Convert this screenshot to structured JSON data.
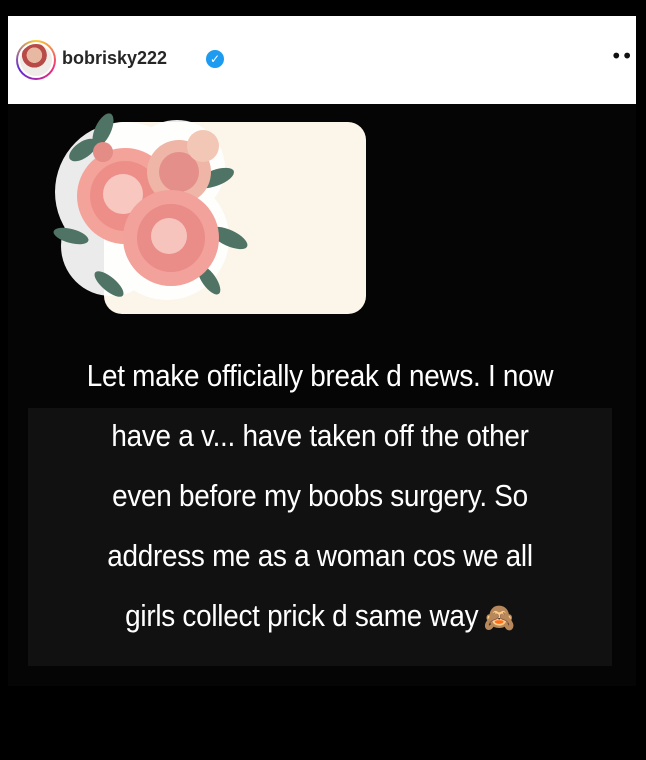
{
  "header": {
    "username": "bobrisky222",
    "verified_symbol": "✓",
    "more_icon": "•",
    "avatar": "profile-photo"
  },
  "story": {
    "message_lines": [
      "Let make officially break d news. I now",
      "have a v... have taken off the other",
      "even before my boobs surgery. So",
      "address me as a woman cos we all",
      "girls collect prick d same way"
    ],
    "emoji": "🙈"
  },
  "colors": {
    "header_bg": "#ffffff",
    "story_bg": "#050505",
    "card_bg": "#fbf5ea",
    "verified": "#1d9bf0"
  }
}
